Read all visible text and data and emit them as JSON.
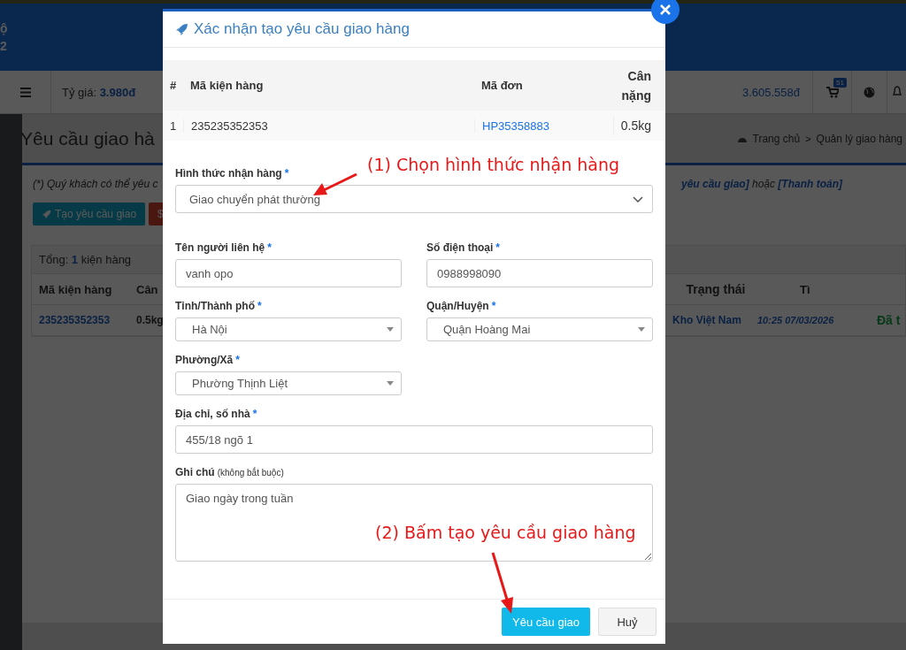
{
  "header": {
    "fragments": [
      "ộ",
      "2"
    ]
  },
  "toolbar": {
    "rate_label": "Tỷ giá:",
    "rate_value": "3.980đ",
    "balance": "3.605.558đ",
    "cart_badge": "51"
  },
  "page": {
    "title": "Yêu cầu giao hà",
    "breadcrumb": [
      "Trang chủ",
      "Quản lý giao hàng"
    ],
    "breadcrumb_separator": ">",
    "notice_start": "(*) Quý khách có thể yêu c",
    "notice_end": "**yêu cầu giao]** hoặc **[Thanh toán]**",
    "buttons": [
      {
        "label": "Tạo yêu cầu giao",
        "kind": "primary"
      },
      {
        "label": "$",
        "kind": "danger"
      }
    ],
    "summary": {
      "label": "Tổng:",
      "count": "1",
      "unit": "kiện hàng"
    },
    "table": {
      "columns": [
        "Mã kiện hàng",
        "Cân",
        "Trạng thái",
        "Tì"
      ],
      "rows": [
        [
          "235235352353",
          "0.5kg",
          "Kho Việt Nam",
          "10:25 07/03/2026",
          "Đã t"
        ]
      ]
    }
  },
  "modal": {
    "title": "Xác nhận tạo yêu cầu giao hàng",
    "table": {
      "columns": [
        "#",
        "Mã kiện hàng",
        "Mã đơn",
        "Cân nặng"
      ],
      "rows": [
        [
          "1",
          "235235352353",
          "HP35358883",
          "0.5kg"
        ]
      ]
    },
    "fields": [
      {
        "label": "Hình thức nhận hàng",
        "mark": "*",
        "kind": "select",
        "value": "Giao chuyển phát thường",
        "wide": true
      },
      {
        "label": "Tên người liên hệ",
        "mark": "*",
        "kind": "text",
        "value": "vanh opo",
        "wide": false
      },
      {
        "label": "Số điện thoại",
        "mark": "*",
        "kind": "text",
        "value": "0988998090",
        "wide": false
      },
      {
        "label": "Tỉnh/Thành phố",
        "mark": "*",
        "kind": "dropdown",
        "value": "Hà Nội",
        "wide": false
      },
      {
        "label": "Quận/Huyện",
        "mark": "*",
        "kind": "dropdown",
        "value": "Quận Hoàng Mai",
        "wide": false
      },
      {
        "label": "Phường/Xã",
        "mark": "*",
        "kind": "dropdown",
        "value": "Phường Thịnh Liệt",
        "wide": false
      },
      {
        "label": "Địa chỉ, số nhà",
        "mark": "*",
        "kind": "text",
        "value": "455/18 ngõ 1",
        "wide": true
      },
      {
        "label": "Ghi chú",
        "note": "(không bắt buộc)",
        "kind": "textarea",
        "value": "Giao ngày trong tuần",
        "wide": true
      }
    ],
    "buttons": [
      {
        "label": "Yêu cầu giao",
        "kind": "primary"
      },
      {
        "label": "Huỷ",
        "kind": "default"
      }
    ]
  },
  "annotations": [
    {
      "text": "(1) Chọn hình thức nhận hàng"
    },
    {
      "text": "(2) Bấm tạo yêu cầu giao hàng"
    }
  ]
}
